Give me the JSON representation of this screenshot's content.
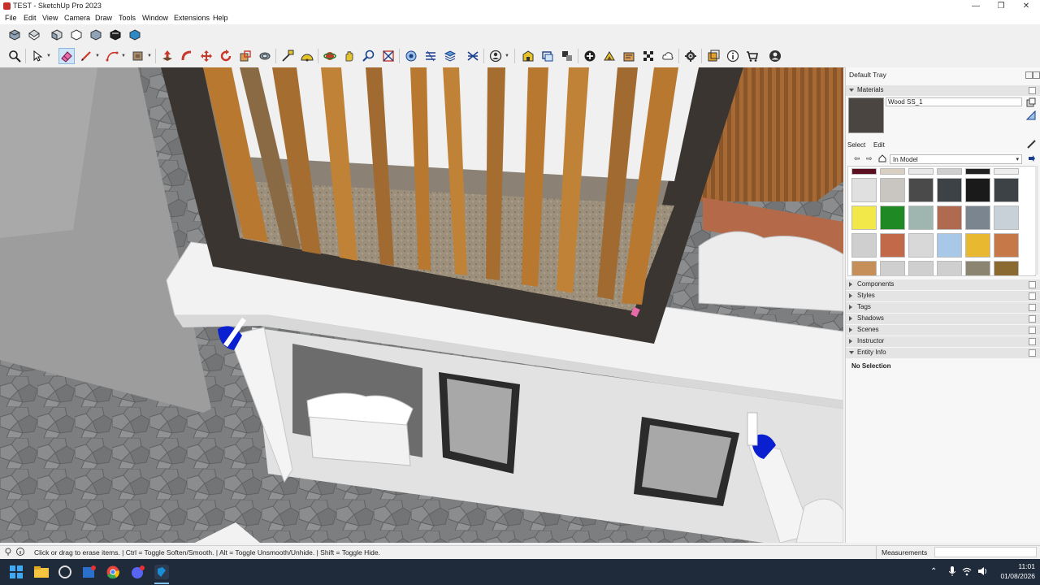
{
  "window": {
    "title": "TEST - SketchUp Pro 2023",
    "minimize_glyph": "—",
    "restore_glyph": "❐",
    "close_glyph": "✕"
  },
  "menu": [
    "File",
    "Edit",
    "View",
    "Camera",
    "Draw",
    "Tools",
    "Window",
    "Extensions",
    "Help"
  ],
  "toolbar1": {
    "icons": [
      "iso-view-icon",
      "top-view-icon",
      "front-view-icon",
      "right-view-icon",
      "back-view-icon",
      "left-view-icon",
      "bottom-view-icon"
    ]
  },
  "toolbar2": {
    "active_tool": "eraser",
    "icons": [
      "zoom-icon",
      "select-icon",
      "eraser-icon",
      "pencil-line-icon",
      "shape-icon",
      "paint-bucket-icon",
      "push-pull-icon",
      "follow-me-icon",
      "move-icon",
      "rotate-icon",
      "scale-icon",
      "offset-icon",
      "tape-measure-icon",
      "protractor-icon",
      "orbit-icon",
      "pan-icon",
      "zoom-window-icon",
      "zoom-extents-icon",
      "section-plane-icon",
      "xray-icon",
      "shadows-icon",
      "fog-icon",
      "user-icon",
      "warehouse-icon",
      "extension-icon",
      "solid-tools-icon",
      "add-location-icon",
      "sandbox-icon",
      "dimensions-icon",
      "text-icon",
      "cloud-icon",
      "settings-icon",
      "outliner-icon",
      "instructor-icon",
      "cart-icon",
      "account-icon"
    ]
  },
  "tray": {
    "title": "Default Tray",
    "materials": {
      "label": "Materials",
      "material_name": "Wood SS_1",
      "select_tab": "Select",
      "edit_tab": "Edit",
      "collection": "In Model"
    },
    "panels": [
      {
        "label": "Components"
      },
      {
        "label": "Styles"
      },
      {
        "label": "Tags"
      },
      {
        "label": "Shadows"
      },
      {
        "label": "Scenes"
      },
      {
        "label": "Instructor"
      },
      {
        "label": "Entity Info"
      }
    ],
    "entity_info_text": "No Selection"
  },
  "status": {
    "hint": "Click or drag to erase items. | Ctrl = Toggle Soften/Smooth. | Alt = Toggle Unsmooth/Unhide. | Shift = Toggle Hide.",
    "measurements_label": "Measurements"
  },
  "taskbar": {
    "time": "11:01",
    "date": "01/08/2026"
  },
  "colors": {
    "accent": "#8cb7e0",
    "frame": "#3a3530",
    "wood": "#b8782f",
    "beacon": "#0a1fd0"
  }
}
